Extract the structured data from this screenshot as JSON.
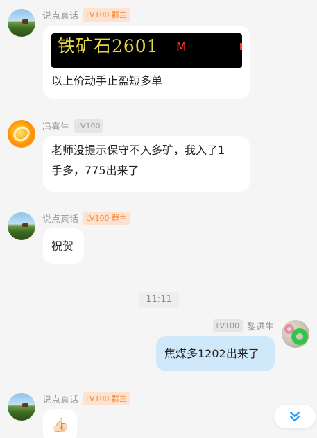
{
  "messages": [
    {
      "sender": "说点真话",
      "badge": "LV100 群主",
      "stock_name": "铁矿石2601",
      "stock_flag": "M",
      "text": "以上价动手止盈短多单"
    },
    {
      "sender": "冯喜生",
      "badge": "LV100",
      "text_line1": "老师没提示保守不入多矿，我入了1",
      "text_line2": "手多，775出来了"
    },
    {
      "sender": "说点真话",
      "badge": "LV100 群主",
      "text": "祝贺"
    },
    {
      "sender": "黎进生",
      "badge": "LV100",
      "text": "焦煤多1202出来了"
    },
    {
      "sender": "说点真话",
      "badge": "LV100 群主",
      "emoji": "👍🏻"
    }
  ],
  "time_divider": "11:11",
  "colors": {
    "background": "#f5f5f5",
    "bubble_other": "#ffffff",
    "bubble_mine": "#cfe9fb",
    "owner_badge_bg": "#fde3cf",
    "owner_badge_text": "#f08c3c",
    "scroll_chevron": "#2a9df4"
  },
  "icons": {
    "scroll_down": "double-chevron-down-icon"
  }
}
